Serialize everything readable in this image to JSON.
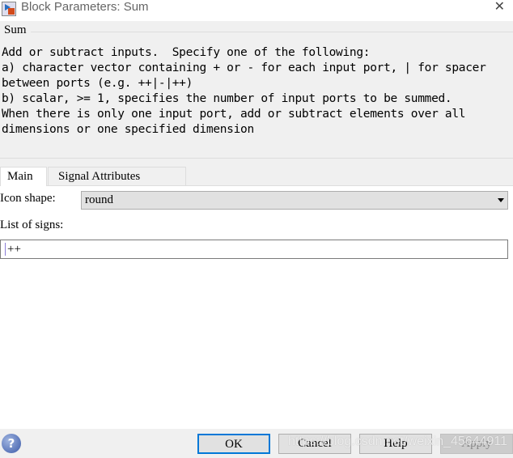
{
  "window": {
    "title": "Block Parameters: Sum",
    "close_icon": "close-icon"
  },
  "description": {
    "group_label": "Sum",
    "lines": [
      "Add or subtract inputs.  Specify one of the following:",
      "a) character vector containing + or - for each input port, | for spacer",
      "between ports (e.g. ++|-|++)",
      "b) scalar, >= 1, specifies the number of input ports to be summed.",
      "When there is only one input port, add or subtract elements over all",
      "dimensions or one specified dimension"
    ]
  },
  "tabs": [
    {
      "label": "Main",
      "active": true
    },
    {
      "label": "Signal Attributes",
      "active": false
    }
  ],
  "main": {
    "icon_shape_label": "Icon shape:",
    "icon_shape_value": "round",
    "list_of_signs_label": "List of signs:",
    "list_of_signs_value": "++"
  },
  "buttons": {
    "ok": "OK",
    "cancel": "Cancel",
    "help": "Help",
    "apply": "Apply"
  },
  "watermark": "https://blog.csdn.net/weixin_45644911"
}
